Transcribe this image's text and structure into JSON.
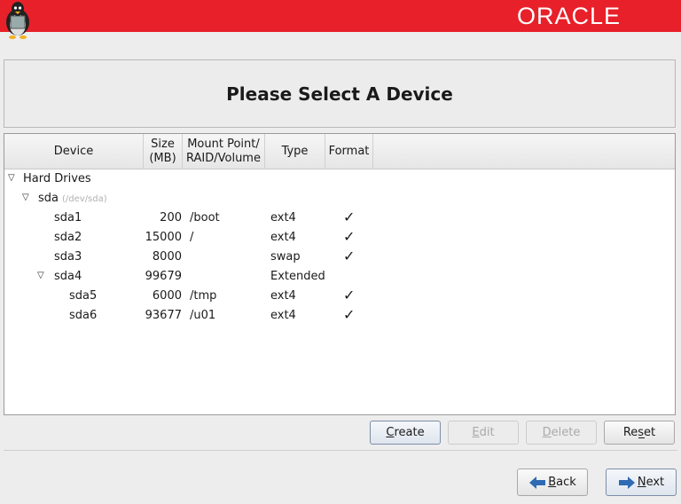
{
  "header": {
    "brand": "ORACLE"
  },
  "title": "Please Select A Device",
  "table": {
    "columns": [
      "Device",
      "Size\n(MB)",
      "Mount Point/\nRAID/Volume",
      "Type",
      "Format"
    ],
    "group": "Hard Drives",
    "disk": {
      "name": "sda",
      "path": "(/dev/sda)"
    },
    "rows": [
      {
        "device": "sda1",
        "size": "200",
        "mount": "/boot",
        "type": "ext4",
        "format": true,
        "level": 2
      },
      {
        "device": "sda2",
        "size": "15000",
        "mount": "/",
        "type": "ext4",
        "format": true,
        "level": 2
      },
      {
        "device": "sda3",
        "size": "8000",
        "mount": "",
        "type": "swap",
        "format": true,
        "level": 2
      },
      {
        "device": "sda4",
        "size": "99679",
        "mount": "",
        "type": "Extended",
        "format": false,
        "level": 2,
        "expanded": true
      },
      {
        "device": "sda5",
        "size": "6000",
        "mount": "/tmp",
        "type": "ext4",
        "format": true,
        "level": 3
      },
      {
        "device": "sda6",
        "size": "93677",
        "mount": "/u01",
        "type": "ext4",
        "format": true,
        "level": 3
      }
    ],
    "check_glyph": "✓"
  },
  "buttons": {
    "create": {
      "label": "Create",
      "mnemonic": 0
    },
    "edit": {
      "label": "Edit",
      "mnemonic": 0
    },
    "delete": {
      "label": "Delete",
      "mnemonic": 0
    },
    "reset": {
      "label": "Reset",
      "mnemonic": 2
    },
    "back": {
      "label": "Back",
      "mnemonic": 0
    },
    "next": {
      "label": "Next",
      "mnemonic": 0
    }
  },
  "colors": {
    "banner": "#e8202a",
    "arrow": "#2f6bb3"
  }
}
